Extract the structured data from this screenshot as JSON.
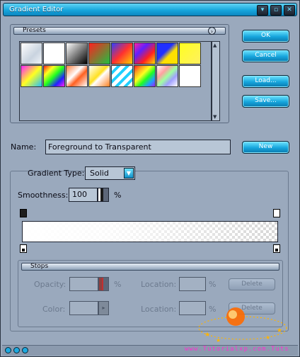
{
  "window": {
    "title": "Gradient Editor"
  },
  "titlebar_buttons": [
    {
      "name": "collapse",
      "glyph": "▾"
    },
    {
      "name": "restore",
      "glyph": "▫"
    },
    {
      "name": "close",
      "glyph": "✕"
    }
  ],
  "presets": {
    "title": "Presets",
    "menu_icon": "chevron-right-icon"
  },
  "buttons": {
    "ok": "OK",
    "cancel": "Cancel",
    "load": "Load...",
    "save": "Save...",
    "new": "New"
  },
  "name_field": {
    "label": "Name:",
    "value": "Foreground to Transparent"
  },
  "gradient": {
    "type_label": "Gradient Type:",
    "type_value": "Solid",
    "smoothness_label": "Smoothness:",
    "smoothness_value": "100",
    "smoothness_unit": "%"
  },
  "stops": {
    "title": "Stops",
    "opacity_label": "Opacity:",
    "opacity_unit": "%",
    "location_label_1": "Location:",
    "location_unit_1": "%",
    "delete_1": "Delete",
    "color_label": "Color:",
    "location_label_2": "Location:",
    "location_unit_2": "%",
    "delete_2": "Delete"
  },
  "watermark": "www.Tutorialxp.com.Tuts",
  "colors": {
    "accent": "#16a5dc",
    "window_bg": "#9aa9bd",
    "field_bg": "#b8c6d6"
  }
}
